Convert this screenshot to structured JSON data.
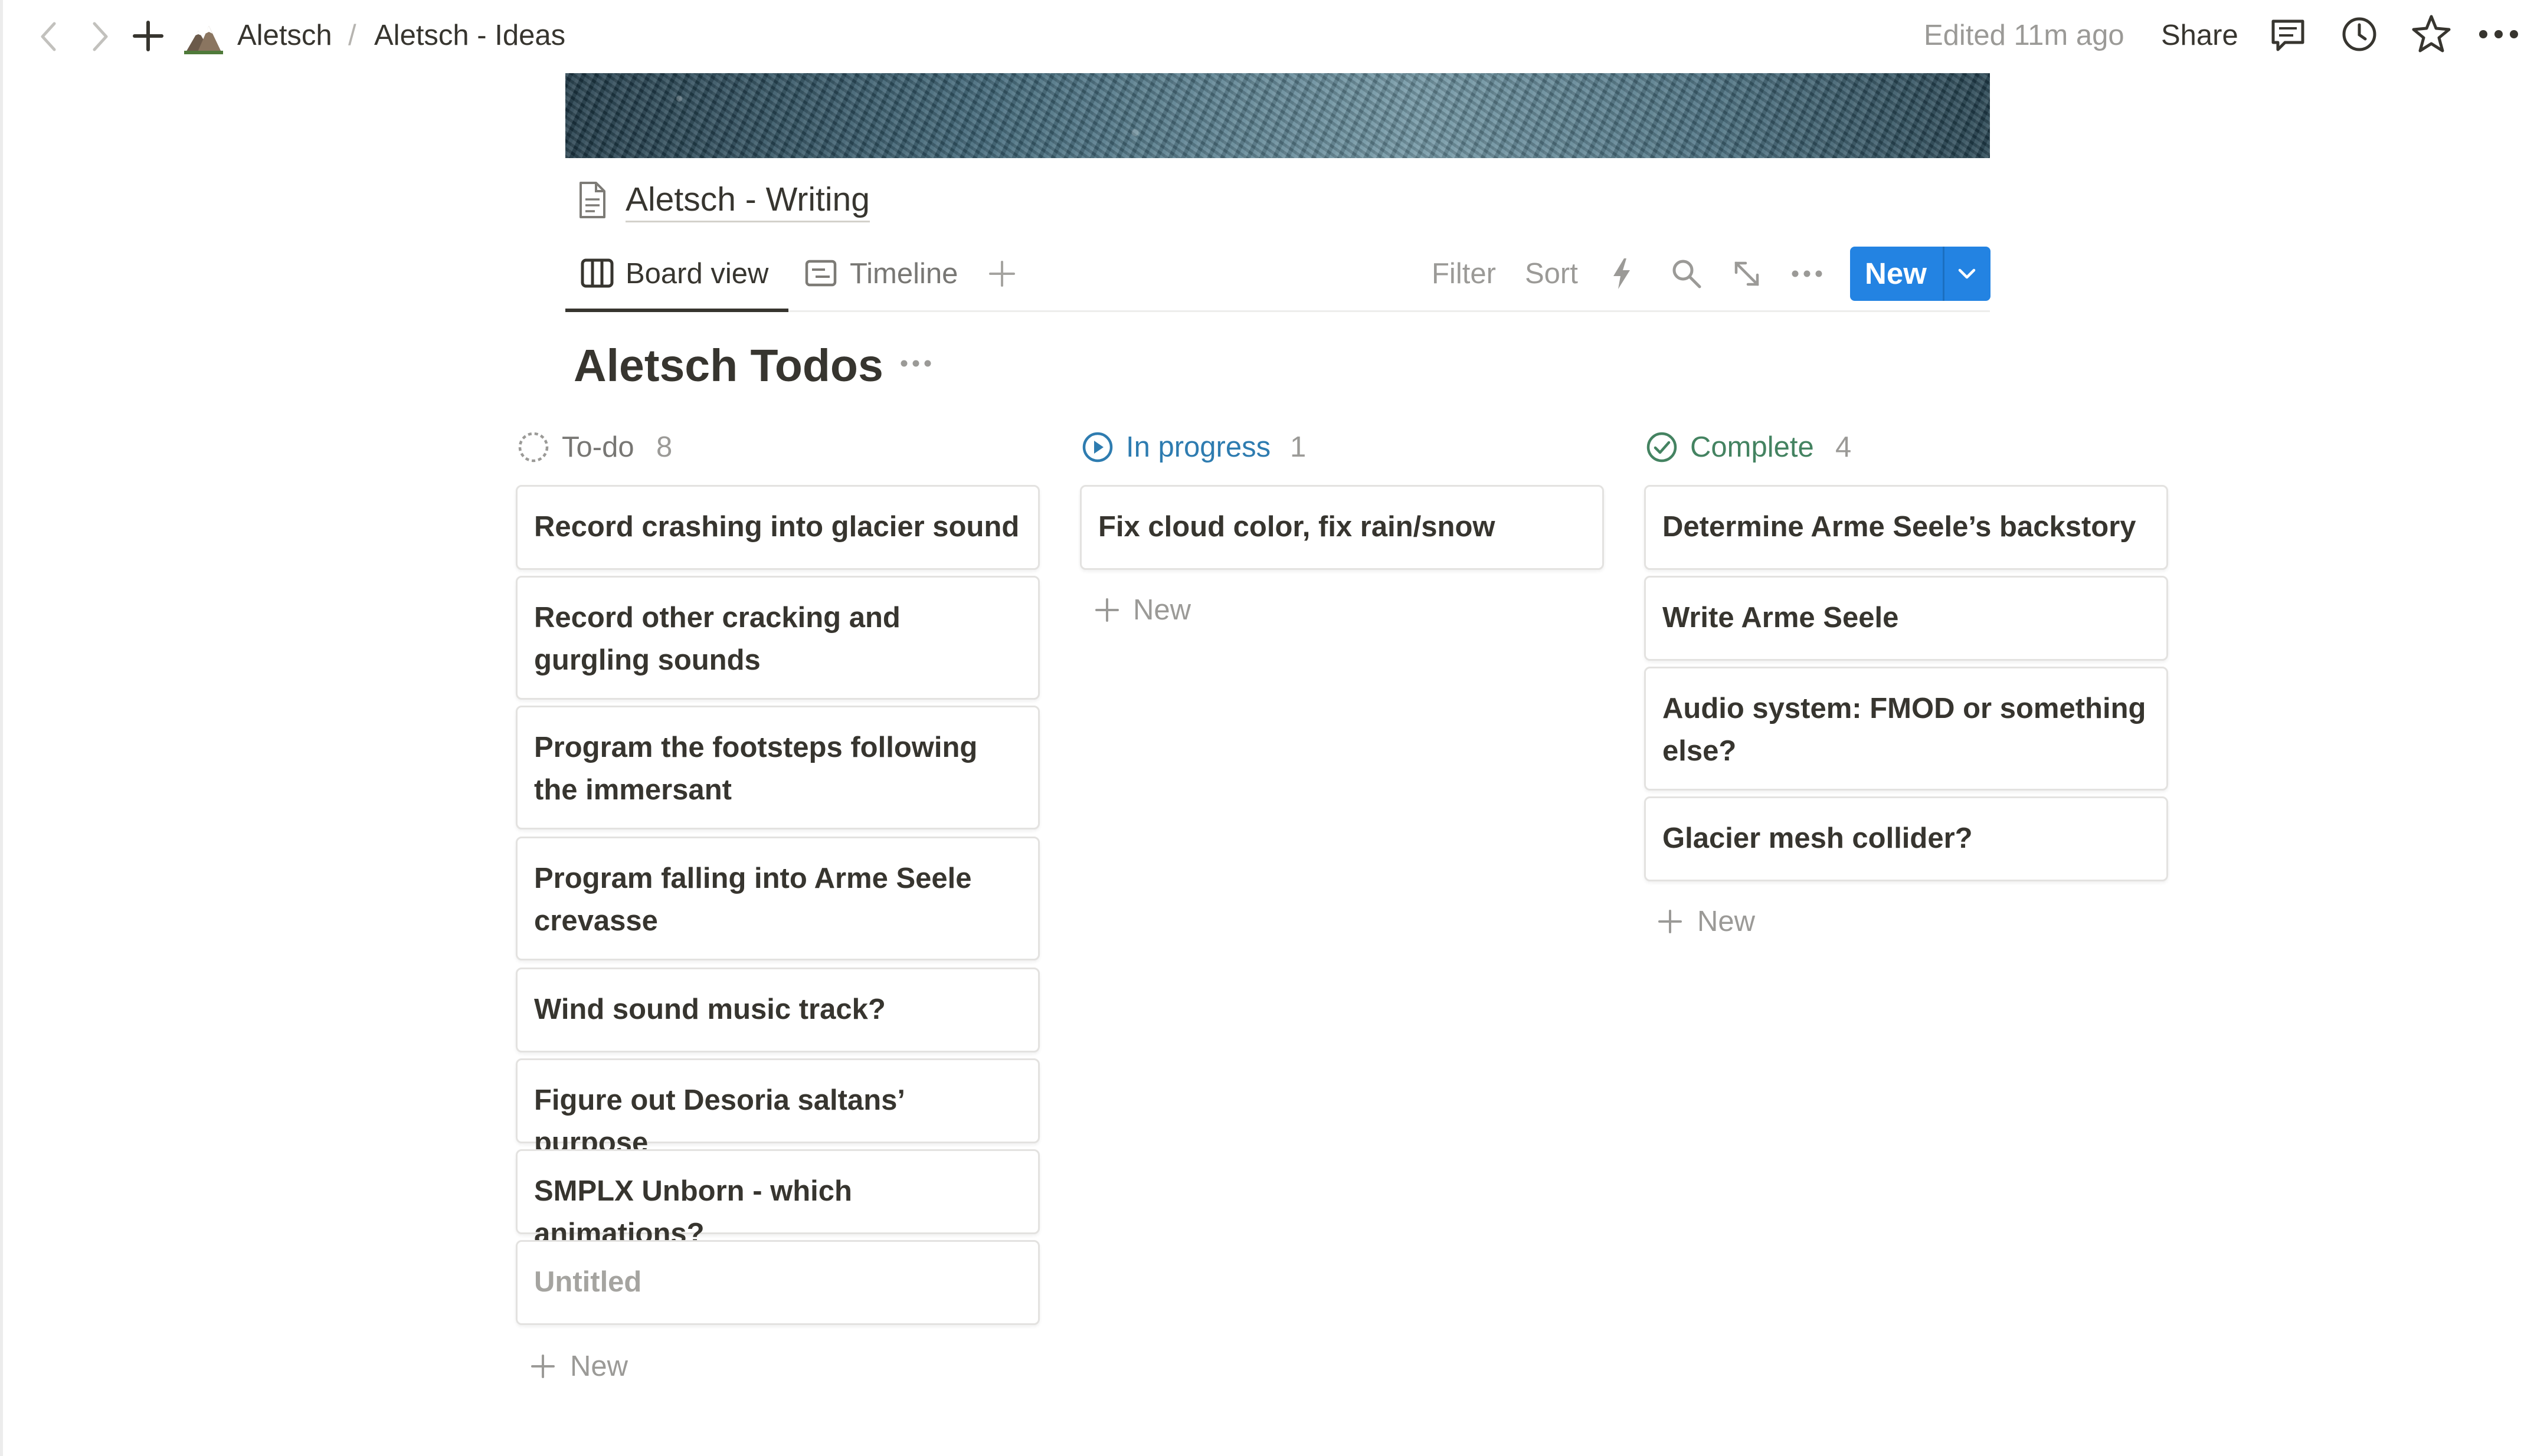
{
  "breadcrumb": {
    "workspace": "Aletsch",
    "separator": "/",
    "page": "Aletsch - Ideas"
  },
  "topbar": {
    "edited": "Edited 11m ago",
    "share": "Share"
  },
  "database": {
    "title": "Aletsch - Writing"
  },
  "views": {
    "tabs": [
      {
        "label": "Board view",
        "icon": "board-icon",
        "active": true
      },
      {
        "label": "Timeline",
        "icon": "timeline-icon",
        "active": false
      }
    ],
    "filter": "Filter",
    "sort": "Sort",
    "new_button": "New"
  },
  "board": {
    "title": "Aletsch Todos",
    "add_label": "New",
    "columns": [
      {
        "name": "To-do",
        "count": "8",
        "color": "#787774",
        "cards": [
          "Record crashing into glacier sound",
          "Record other cracking and gurgling sounds",
          "Program the footsteps following the immersant",
          "Program falling into Arme Seele crevasse",
          "Wind sound music track?",
          "Figure out Desoria saltans’ purpose",
          "SMPLX Unborn - which animations?",
          "Untitled"
        ]
      },
      {
        "name": "In progress",
        "count": "1",
        "color": "#2e7cb0",
        "cards": [
          "Fix cloud color, fix rain/snow"
        ]
      },
      {
        "name": "Complete",
        "count": "4",
        "color": "#448361",
        "cards": [
          "Determine Arme Seele’s backstory",
          "Write Arme Seele",
          "Audio system: FMOD or something else?",
          "Glacier mesh collider?"
        ]
      }
    ]
  },
  "colors": {
    "accent": "#2383e2",
    "text": "#37352f",
    "muted": "#9b9a97"
  }
}
